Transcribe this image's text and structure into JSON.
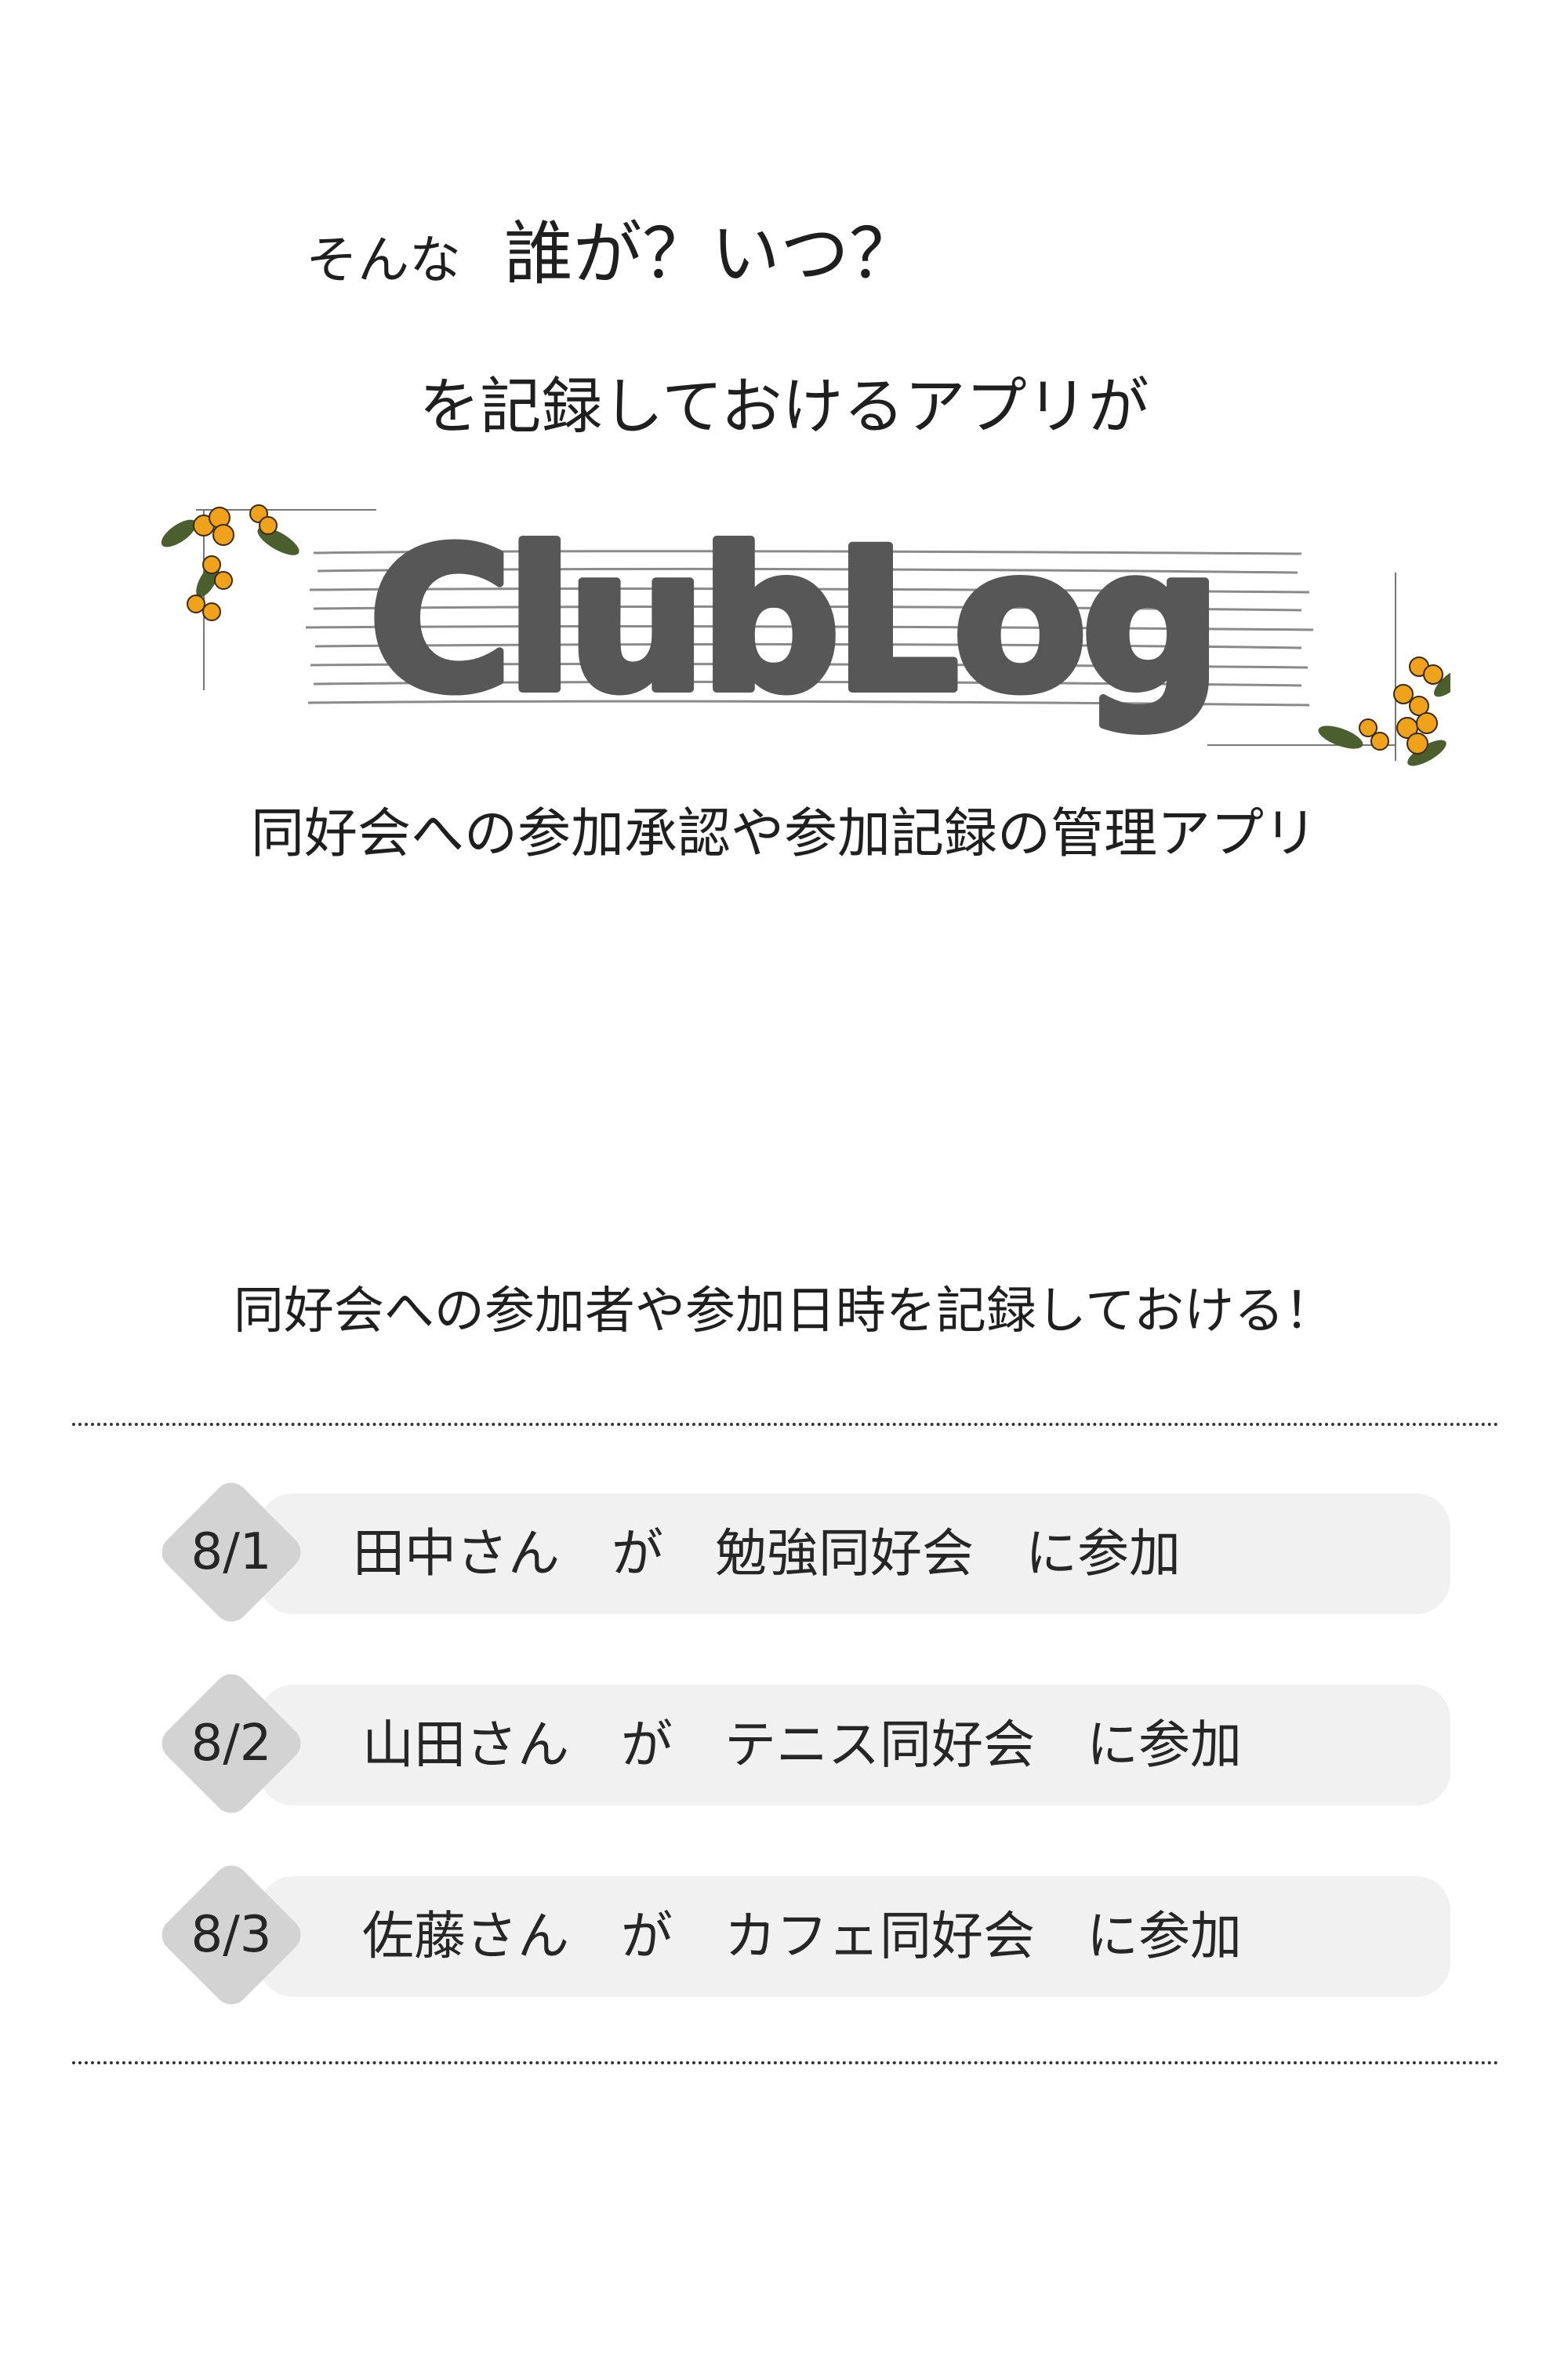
{
  "tagline": {
    "prefix": "そんな",
    "question": "誰が？いつ？",
    "line2": "を記録しておけるアプリが"
  },
  "logo": {
    "text": "ClubLog"
  },
  "subtitle": "同好会への参加承認や参加記録の管理アプリ",
  "section": {
    "heading": "同好会への参加者や参加日時を記録しておける！",
    "records": [
      {
        "date": "8/1",
        "sentence": "田中さん　が　勉強同好会　に参加"
      },
      {
        "date": "8/2",
        "sentence": "山田さん　が　テニス同好会　に参加"
      },
      {
        "date": "8/3",
        "sentence": "佐藤さん　が　カフェ同好会　に参加"
      }
    ]
  },
  "colors": {
    "logo_fill": "#575757",
    "flower": "#f0a31a",
    "leaf": "#4a5e2e",
    "badge": "#d3d3d3",
    "row_bg": "#f1f1f1"
  }
}
